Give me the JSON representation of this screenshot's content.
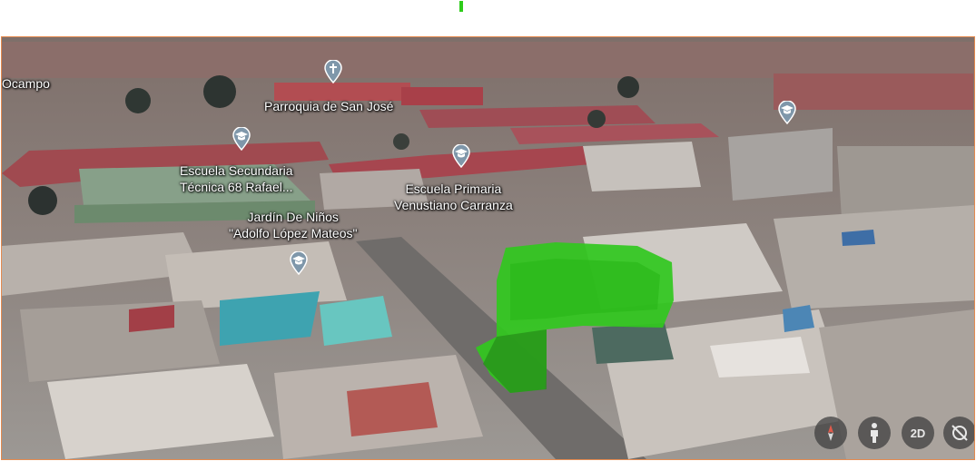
{
  "labels": {
    "ocampo": "Ocampo",
    "parroquia": "Parroquia de San José",
    "escuela_sec_l1": "Escuela Secundaria",
    "escuela_sec_l2": "Técnica 68 Rafael...",
    "escuela_pri_l1": "Escuela Primaria",
    "escuela_pri_l2": "Venustiano Carranza",
    "jardin_l1": "Jardín De Niños",
    "jardin_l2": "\"Adolfo López Mateos\""
  },
  "pins": [
    {
      "name": "church",
      "icon": "church-pin-icon"
    },
    {
      "name": "school-secundaria",
      "icon": "school-pin-icon"
    },
    {
      "name": "school-primaria",
      "icon": "school-pin-icon"
    },
    {
      "name": "school-jardin",
      "icon": "school-pin-icon"
    },
    {
      "name": "school-right",
      "icon": "school-pin-icon"
    }
  ],
  "controls": {
    "compass": "compass-icon",
    "pegman": "pegman-icon",
    "view_2d": "2D",
    "reset_tilt": "tilt-icon"
  },
  "colors": {
    "frame_border": "#e58a4f",
    "highlight": "#31c81e",
    "pin": "#7f97aa"
  }
}
